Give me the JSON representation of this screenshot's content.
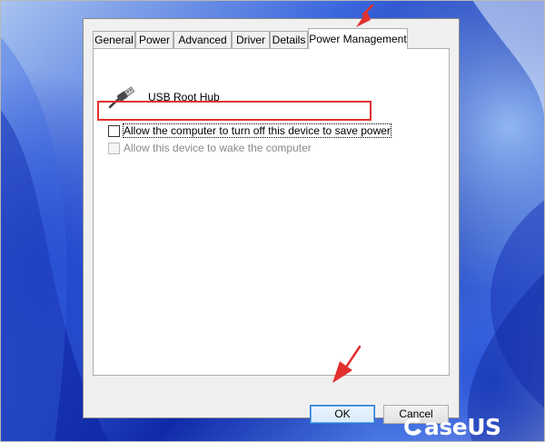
{
  "dialog": {
    "tabs": [
      {
        "label": "General",
        "active": false
      },
      {
        "label": "Power",
        "active": false
      },
      {
        "label": "Advanced",
        "active": false
      },
      {
        "label": "Driver",
        "active": false
      },
      {
        "label": "Details",
        "active": false
      },
      {
        "label": "Power Management",
        "active": true
      }
    ],
    "device": {
      "name": "USB Root Hub",
      "icon": "usb-cable-icon"
    },
    "options": [
      {
        "label": "Allow the computer to turn off this device to save power",
        "checked": false,
        "enabled": true
      },
      {
        "label": "Allow this device to wake the computer",
        "checked": false,
        "enabled": false
      }
    ],
    "buttons": {
      "ok": "OK",
      "cancel": "Cancel"
    }
  },
  "annotations": {
    "highlight_color": "#e2302f",
    "arrow_color": "#e2302f"
  },
  "watermark": {
    "brand_rest": "aseUS",
    "brand_mark": "easeus-logo-icon"
  }
}
